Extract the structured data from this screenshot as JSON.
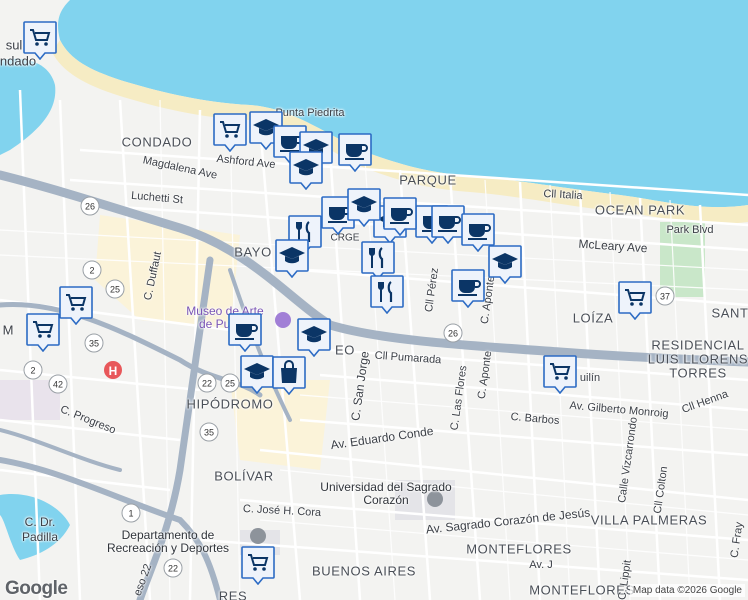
{
  "colors": {
    "water": "#81d3ee",
    "land": "#f3f3f1",
    "highway": "#a5b3c4",
    "road": "#ffffff",
    "park": "#c9e7c9",
    "marker_fill": "#eef3fb",
    "marker_border": "#2c6bc4",
    "marker_icon": "#0b3566"
  },
  "neighborhoods": [
    {
      "name": "CONDADO",
      "icon": "label"
    },
    {
      "name": "PARQUE",
      "icon": "label"
    },
    {
      "name": "OCEAN PARK",
      "icon": "label"
    },
    {
      "name": "LOÍZA",
      "icon": "label"
    },
    {
      "name": "SANT",
      "icon": "label"
    },
    {
      "name": "RESIDENCIAL",
      "icon": "label"
    },
    {
      "name": "LUIS LLORENS",
      "icon": "label"
    },
    {
      "name": "TORRES",
      "icon": "label"
    },
    {
      "name": "HIPÓDROMO",
      "icon": "label"
    },
    {
      "name": "BOLÍVAR",
      "icon": "label"
    },
    {
      "name": "MONTEFLORES",
      "icon": "label"
    },
    {
      "name": "VILLA PALMERAS",
      "icon": "label"
    },
    {
      "name": "MONTEFLORES",
      "icon": "label"
    },
    {
      "name": "BUENOS AIRES",
      "icon": "label"
    },
    {
      "name": "BAYO",
      "icon": "label"
    },
    {
      "name": "EO",
      "icon": "label"
    },
    {
      "name": "RES",
      "icon": "label"
    },
    {
      "name": "Punta Piedrita",
      "icon": "label"
    },
    {
      "name": "sul",
      "icon": "label"
    },
    {
      "name": "ndado",
      "icon": "label"
    }
  ],
  "streets": [
    "Ashford Ave",
    "Magdalena Ave",
    "Luchetti St",
    "Cll Italia",
    "Park Blvd",
    "McLeary Ave",
    "C. Duffaut",
    "Cll Pérez",
    "C. Aponte",
    "C. San Jorge",
    "Cll Pumarada",
    "C. Las Flores",
    "C. Aponte",
    "Av. Eduardo Conde",
    "Av. Gilberto Monroig",
    "C. Barbos",
    "Calle Vizcarrondo",
    "Cll Colton",
    "Cll Henna",
    "C. Progreso",
    "C. José H. Cora",
    "Av. Sagrado Corazón de Jesús",
    "Av. J",
    "C. Lippit",
    "C. Fray",
    "C. Dr.",
    "Padilla",
    "eso 22",
    "uilín",
    "CRGE",
    "M"
  ],
  "pois": {
    "museum": [
      "Museo de Arte",
      "de Puerto"
    ],
    "university": [
      "Universidad del Sagrado",
      "Corazón"
    ],
    "recreation": [
      "Departamento de",
      "Recreación y Deportes"
    ]
  },
  "highway_shields": [
    "26",
    "2",
    "25",
    "35",
    "2",
    "42",
    "22",
    "25",
    "35",
    "26",
    "37",
    "1",
    "22"
  ],
  "markers": [
    {
      "type": "shopping-cart"
    },
    {
      "type": "shopping-cart"
    },
    {
      "type": "graduation-cap"
    },
    {
      "type": "coffee-cup"
    },
    {
      "type": "graduation-cap"
    },
    {
      "type": "coffee-cup"
    },
    {
      "type": "graduation-cap"
    },
    {
      "type": "coffee-cup"
    },
    {
      "type": "graduation-cap"
    },
    {
      "type": "fork-knife"
    },
    {
      "type": "coffee-cup"
    },
    {
      "type": "graduation-cap"
    },
    {
      "type": "coffee-cup"
    },
    {
      "type": "coffee-cup"
    },
    {
      "type": "coffee-cup"
    },
    {
      "type": "graduation-cap"
    },
    {
      "type": "fork-knife"
    },
    {
      "type": "fork-knife"
    },
    {
      "type": "graduation-cap"
    },
    {
      "type": "coffee-cup"
    },
    {
      "type": "shopping-cart"
    },
    {
      "type": "shopping-cart"
    },
    {
      "type": "shopping-cart"
    },
    {
      "type": "coffee-cup"
    },
    {
      "type": "graduation-cap"
    },
    {
      "type": "graduation-cap"
    },
    {
      "type": "shopping-bag"
    },
    {
      "type": "shopping-cart"
    },
    {
      "type": "shopping-cart"
    }
  ],
  "branding": {
    "logo": "Google",
    "attribution": "Map data ©2026 Google"
  }
}
